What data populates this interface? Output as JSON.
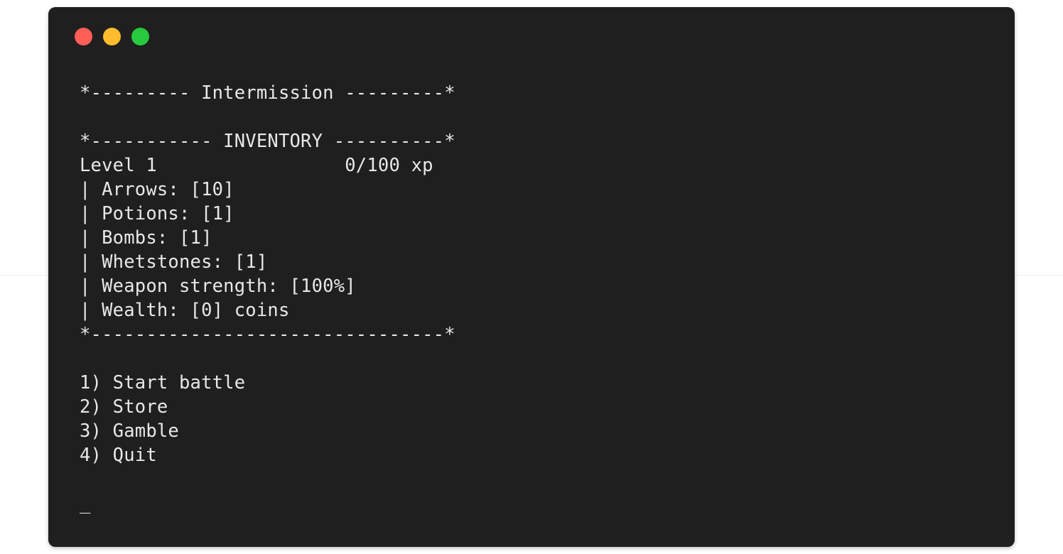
{
  "window": {
    "controls": [
      "close",
      "minimize",
      "maximize"
    ],
    "colors": {
      "background": "#1f1f1f",
      "text": "#e8e8e8",
      "close": "#ff5f56",
      "minimize": "#ffbd2e",
      "maximize": "#27c93f"
    }
  },
  "terminal": {
    "header": "*--------- Intermission ---------*",
    "inventory_header": "*----------- INVENTORY ----------*",
    "level_line": "Level 1                 0/100 xp",
    "items": [
      "| Arrows: [10]",
      "| Potions: [1]",
      "| Bombs: [1]",
      "| Whetstones: [1]",
      "| Weapon strength: [100%]",
      "| Wealth: [0] coins"
    ],
    "inventory_footer": "*--------------------------------*",
    "menu": [
      "1) Start battle",
      "2) Store",
      "3) Gamble",
      "4) Quit"
    ],
    "prompt_cursor": "_"
  }
}
